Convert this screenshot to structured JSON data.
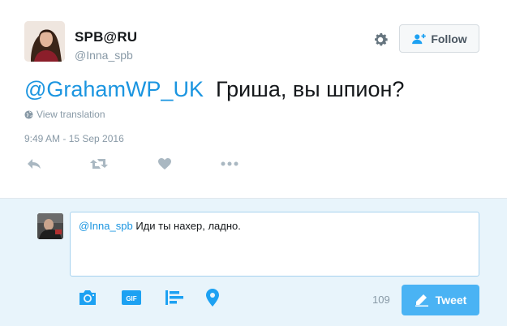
{
  "tweet": {
    "author": {
      "display_name": "SPB@RU",
      "screen_name": "@Inna_spb"
    },
    "follow_label": "Follow",
    "text_mention": "@GrahamWP_UK",
    "text_body": "Гриша, вы шпион?",
    "view_translation": "View translation",
    "timestamp": "9:49 AM - 15 Sep 2016",
    "icons": {
      "settings": "gear-icon",
      "follow": "add-user-icon",
      "globe": "globe-icon",
      "reply": "reply-icon",
      "retweet": "retweet-icon",
      "like": "heart-icon",
      "more": "more-icon"
    }
  },
  "reply": {
    "mention": "@Inna_spb",
    "text": " Иди ты нахер, ладно.",
    "char_count": "109",
    "tweet_label": "Tweet",
    "tools": [
      "camera-icon",
      "gif-icon",
      "poll-icon",
      "location-icon"
    ]
  },
  "colors": {
    "link": "#1b95e0",
    "muted": "#8899a6",
    "action_icon": "#aab8c2",
    "tool_icon": "#1da1f2",
    "tweet_button": "#4ab3f4",
    "reply_bg": "#e8f4fb"
  }
}
